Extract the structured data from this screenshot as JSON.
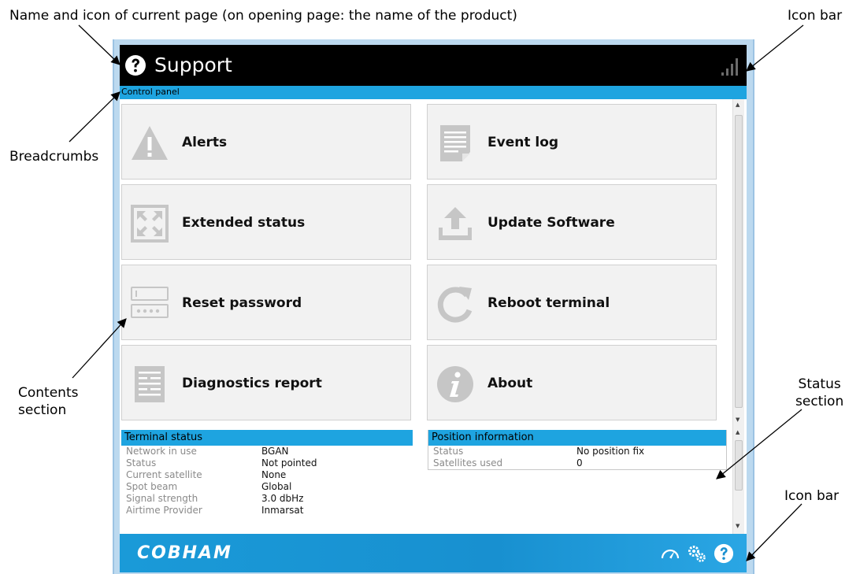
{
  "annotations": {
    "name_icon": "Name and icon of current page (on opening page: the name of the product)",
    "icon_bar_top": "Icon bar",
    "breadcrumbs": "Breadcrumbs",
    "contents_line1": "Contents",
    "contents_line2": "section",
    "status_line1": "Status",
    "status_line2": "section",
    "icon_bar_bottom": "Icon bar"
  },
  "header": {
    "title": "Support",
    "icon": "question-icon",
    "status_icon": "signal-strength-icon"
  },
  "breadcrumb": "Control panel",
  "tiles": [
    {
      "label": "Alerts",
      "icon": "alert-icon"
    },
    {
      "label": "Event log",
      "icon": "event-log-icon"
    },
    {
      "label": "Extended status",
      "icon": "expand-icon"
    },
    {
      "label": "Update Software",
      "icon": "upload-icon"
    },
    {
      "label": "Reset password",
      "icon": "password-icon"
    },
    {
      "label": "Reboot terminal",
      "icon": "reboot-icon"
    },
    {
      "label": "Diagnostics report",
      "icon": "report-icon"
    },
    {
      "label": "About",
      "icon": "info-icon"
    }
  ],
  "terminal_status": {
    "title": "Terminal status",
    "rows": [
      {
        "key": "Network in use",
        "value": "BGAN"
      },
      {
        "key": "Status",
        "value": "Not pointed"
      },
      {
        "key": "Current satellite",
        "value": "None"
      },
      {
        "key": "Spot beam",
        "value": "Global"
      },
      {
        "key": "Signal strength",
        "value": "3.0 dbHz"
      },
      {
        "key": "Airtime Provider",
        "value": "Inmarsat"
      }
    ]
  },
  "position_info": {
    "title": "Position information",
    "rows": [
      {
        "key": "Status",
        "value": "No position fix"
      },
      {
        "key": "Satellites used",
        "value": "0"
      }
    ]
  },
  "footer": {
    "brand": "COBHAM",
    "icons": [
      "dashboard-icon",
      "settings-icon",
      "help-icon"
    ]
  },
  "colors": {
    "accent": "#1ea4e0",
    "header_bg": "#000000",
    "tile_bg": "#f2f2f2",
    "icon_gray": "#c6c6c6"
  }
}
